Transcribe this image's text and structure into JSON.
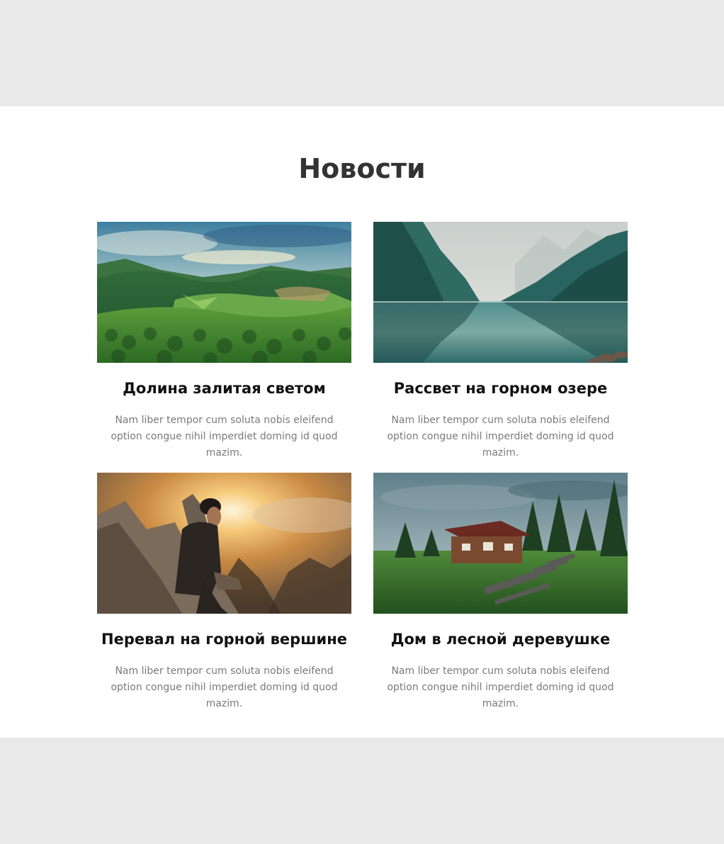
{
  "section": {
    "title": "Новости"
  },
  "colors": {
    "page_bg": "#e9e9e9",
    "section_bg": "#ffffff",
    "title_color": "#333333",
    "card_title_color": "#111111",
    "card_text_color": "#7a7a7a"
  },
  "cards": [
    {
      "title": "Долина залитая светом",
      "text": "Nam liber tempor cum soluta nobis eleifend option congue nihil imperdiet doming id quod mazim.",
      "image": "valley-landscape-image"
    },
    {
      "title": "Рассвет на горном озере",
      "text": "Nam liber tempor cum soluta nobis eleifend option congue nihil imperdiet doming id quod mazim.",
      "image": "mountain-lake-image"
    },
    {
      "title": "Перевал на горной вершине",
      "text": "Nam liber tempor cum soluta nobis eleifend option congue nihil imperdiet doming id quod mazim.",
      "image": "hiker-summit-image"
    },
    {
      "title": "Дом в лесной деревушке",
      "text": "Nam liber tempor cum soluta nobis eleifend option congue nihil imperdiet doming id quod mazim.",
      "image": "forest-cabin-image"
    }
  ]
}
